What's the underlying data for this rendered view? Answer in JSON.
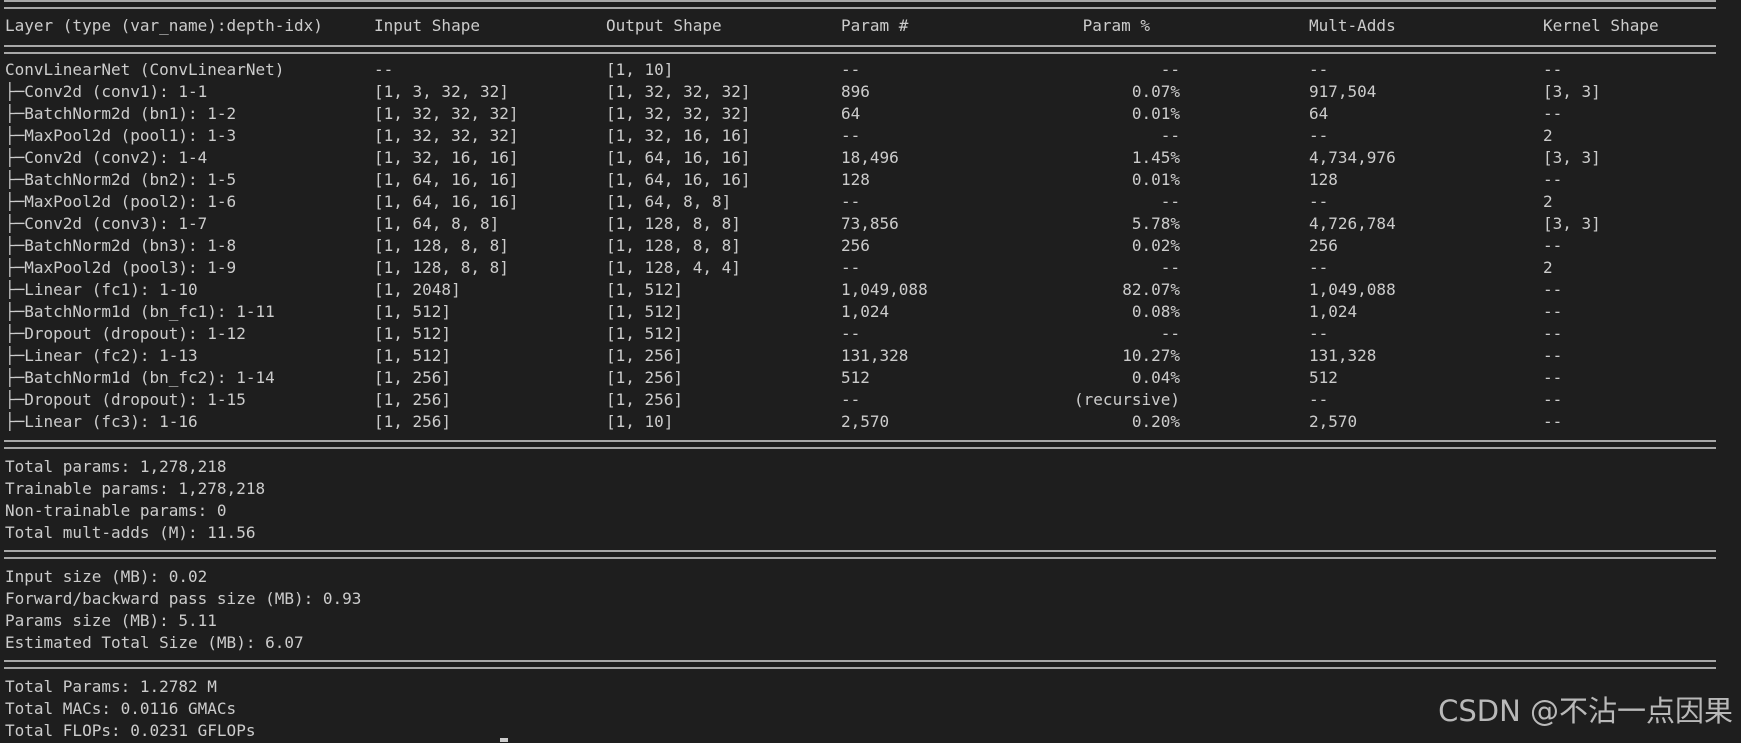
{
  "header": {
    "columns": [
      "Layer (type (var_name):depth-idx)",
      "Input Shape",
      "Output Shape",
      "Param #",
      "Param %",
      "Mult-Adds",
      "Kernel Shape"
    ]
  },
  "rows": [
    {
      "layer": "ConvLinearNet (ConvLinearNet)",
      "input": "--",
      "output": "[1, 10]",
      "params": "--",
      "param_pct": "--",
      "mult_adds": "--",
      "kernel": "--"
    },
    {
      "layer": "├─Conv2d (conv1): 1-1",
      "input": "[1, 3, 32, 32]",
      "output": "[1, 32, 32, 32]",
      "params": "896",
      "param_pct": "0.07%",
      "mult_adds": "917,504",
      "kernel": "[3, 3]"
    },
    {
      "layer": "├─BatchNorm2d (bn1): 1-2",
      "input": "[1, 32, 32, 32]",
      "output": "[1, 32, 32, 32]",
      "params": "64",
      "param_pct": "0.01%",
      "mult_adds": "64",
      "kernel": "--"
    },
    {
      "layer": "├─MaxPool2d (pool1): 1-3",
      "input": "[1, 32, 32, 32]",
      "output": "[1, 32, 16, 16]",
      "params": "--",
      "param_pct": "--",
      "mult_adds": "--",
      "kernel": "2"
    },
    {
      "layer": "├─Conv2d (conv2): 1-4",
      "input": "[1, 32, 16, 16]",
      "output": "[1, 64, 16, 16]",
      "params": "18,496",
      "param_pct": "1.45%",
      "mult_adds": "4,734,976",
      "kernel": "[3, 3]"
    },
    {
      "layer": "├─BatchNorm2d (bn2): 1-5",
      "input": "[1, 64, 16, 16]",
      "output": "[1, 64, 16, 16]",
      "params": "128",
      "param_pct": "0.01%",
      "mult_adds": "128",
      "kernel": "--"
    },
    {
      "layer": "├─MaxPool2d (pool2): 1-6",
      "input": "[1, 64, 16, 16]",
      "output": "[1, 64, 8, 8]",
      "params": "--",
      "param_pct": "--",
      "mult_adds": "--",
      "kernel": "2"
    },
    {
      "layer": "├─Conv2d (conv3): 1-7",
      "input": "[1, 64, 8, 8]",
      "output": "[1, 128, 8, 8]",
      "params": "73,856",
      "param_pct": "5.78%",
      "mult_adds": "4,726,784",
      "kernel": "[3, 3]"
    },
    {
      "layer": "├─BatchNorm2d (bn3): 1-8",
      "input": "[1, 128, 8, 8]",
      "output": "[1, 128, 8, 8]",
      "params": "256",
      "param_pct": "0.02%",
      "mult_adds": "256",
      "kernel": "--"
    },
    {
      "layer": "├─MaxPool2d (pool3): 1-9",
      "input": "[1, 128, 8, 8]",
      "output": "[1, 128, 4, 4]",
      "params": "--",
      "param_pct": "--",
      "mult_adds": "--",
      "kernel": "2"
    },
    {
      "layer": "├─Linear (fc1): 1-10",
      "input": "[1, 2048]",
      "output": "[1, 512]",
      "params": "1,049,088",
      "param_pct": "82.07%",
      "mult_adds": "1,049,088",
      "kernel": "--"
    },
    {
      "layer": "├─BatchNorm1d (bn_fc1): 1-11",
      "input": "[1, 512]",
      "output": "[1, 512]",
      "params": "1,024",
      "param_pct": "0.08%",
      "mult_adds": "1,024",
      "kernel": "--"
    },
    {
      "layer": "├─Dropout (dropout): 1-12",
      "input": "[1, 512]",
      "output": "[1, 512]",
      "params": "--",
      "param_pct": "--",
      "mult_adds": "--",
      "kernel": "--"
    },
    {
      "layer": "├─Linear (fc2): 1-13",
      "input": "[1, 512]",
      "output": "[1, 256]",
      "params": "131,328",
      "param_pct": "10.27%",
      "mult_adds": "131,328",
      "kernel": "--"
    },
    {
      "layer": "├─BatchNorm1d (bn_fc2): 1-14",
      "input": "[1, 256]",
      "output": "[1, 256]",
      "params": "512",
      "param_pct": "0.04%",
      "mult_adds": "512",
      "kernel": "--"
    },
    {
      "layer": "├─Dropout (dropout): 1-15",
      "input": "[1, 256]",
      "output": "[1, 256]",
      "params": "--",
      "param_pct": "(recursive)",
      "mult_adds": "--",
      "kernel": "--"
    },
    {
      "layer": "├─Linear (fc3): 1-16",
      "input": "[1, 256]",
      "output": "[1, 10]",
      "params": "2,570",
      "param_pct": "0.20%",
      "mult_adds": "2,570",
      "kernel": "--"
    }
  ],
  "totals": [
    "Total params: 1,278,218",
    "Trainable params: 1,278,218",
    "Non-trainable params: 0",
    "Total mult-adds (M): 11.56"
  ],
  "sizes": [
    "Input size (MB): 0.02",
    "Forward/backward pass size (MB): 0.93",
    "Params size (MB): 5.11",
    "Estimated Total Size (MB): 6.07"
  ],
  "profile": [
    "Total Params: 1.2782 M",
    "Total MACs: 0.0116 GMACs",
    "Total FLOPs: 0.0231 GFLOPs"
  ],
  "watermark": "CSDN @不沾一点因果",
  "colors": {
    "background": "#1e1e1e",
    "text": "#cccccc",
    "separator": "#a8a8a8"
  }
}
